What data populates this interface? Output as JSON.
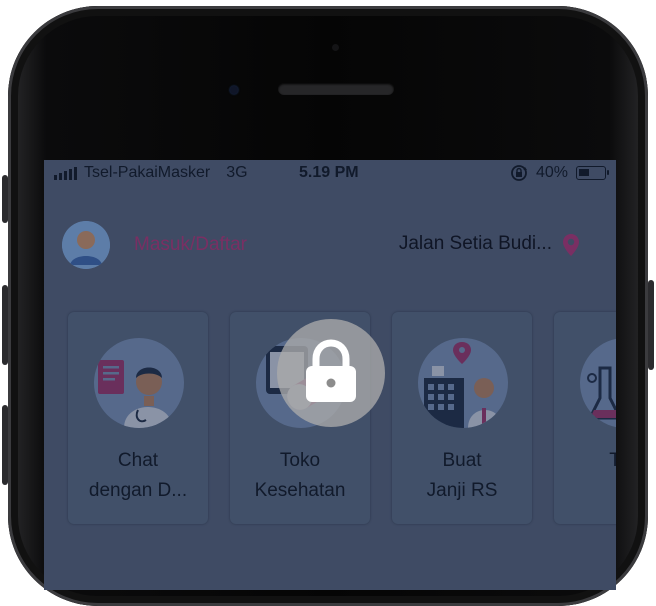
{
  "statusbar": {
    "carrier": "Tsel-PakaiMasker",
    "network": "3G",
    "time": "5.19 PM",
    "battery": "40%",
    "battery_level": 0.4
  },
  "header": {
    "login_label": "Masuk/Daftar",
    "location": "Jalan Setia Budi..."
  },
  "menu": [
    {
      "line1": "Chat",
      "line2": "dengan D..."
    },
    {
      "line1": "Toko",
      "line2": "Kesehatan"
    },
    {
      "line1": "Buat",
      "line2": "Janji RS"
    },
    {
      "line1": "Tes",
      "line2": ""
    }
  ],
  "colors": {
    "overlay": "#3f4b64",
    "accent": "#7a2f63",
    "lock_bg": "#aaaaaa"
  },
  "icons": {
    "lock": "lock-icon",
    "location": "map-pin-icon",
    "orientation_lock": "orientation-lock-icon"
  }
}
